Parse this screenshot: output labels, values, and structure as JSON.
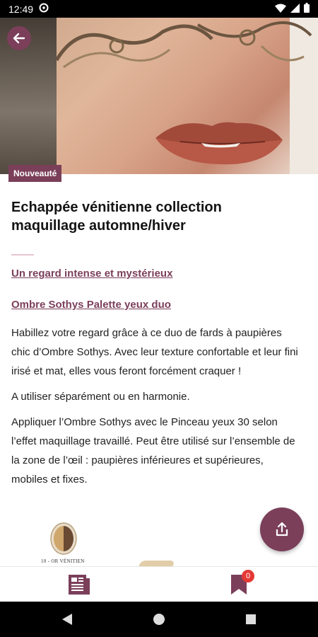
{
  "status_bar": {
    "time": "12:49"
  },
  "hero": {
    "badge": "Nouveauté"
  },
  "article": {
    "title": "Echappée vénitienne collection maquillage automne/hiver",
    "subtitle_1": "Un regard intense et mystérieux",
    "subtitle_2": "Ombre Sothys Palette yeux duo",
    "paragraphs": [
      "Habillez votre regard grâce à ce duo de fards à paupières chic d’Ombre Sothys. Avec leur texture confortable et leur fini irisé et mat, elles vous feront forcément craquer !",
      "A utiliser séparément ou en harmonie.",
      "Appliquer l’Ombre Sothys avec le Pinceau yeux 30 selon l’effet maquillage travaillé. Peut être utilisé sur l’ensemble de la zone de l’œil : paupières inférieures et supérieures, mobiles et fixes."
    ],
    "product_label": "10 - OR VÉNITIEN"
  },
  "bottom_nav": {
    "favorites_count": "0"
  },
  "colors": {
    "brand": "#7b3f5a",
    "badge_red": "#e53935",
    "divider": "#e8c6cf"
  },
  "icons": [
    "back-arrow-icon",
    "share-icon",
    "articles-icon",
    "bookmark-icon",
    "wifi-icon",
    "signal-icon",
    "battery-icon",
    "data-saver-icon"
  ]
}
